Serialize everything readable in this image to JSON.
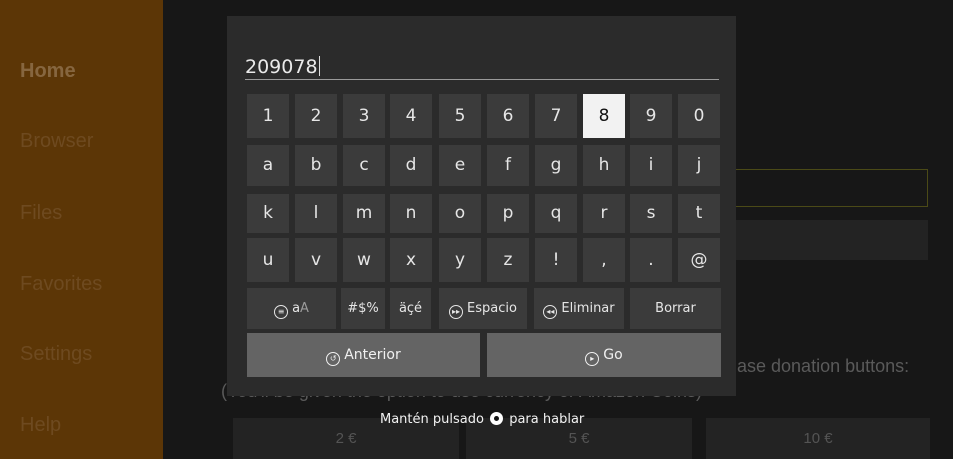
{
  "sidebar": {
    "items": [
      {
        "label": "Home"
      },
      {
        "label": "Browser"
      },
      {
        "label": "Files"
      },
      {
        "label": "Favorites"
      },
      {
        "label": "Settings"
      },
      {
        "label": "Help"
      }
    ]
  },
  "background": {
    "donation_text": "ase donation buttons:",
    "donation_sub": "(You'll be given the option to use currency or Amazon Coins)",
    "buttons": [
      "2 €",
      "5 €",
      "10 €"
    ]
  },
  "keyboard": {
    "input_value": "209078",
    "rows": [
      [
        "1",
        "2",
        "3",
        "4",
        "5",
        "6",
        "7",
        "8",
        "9",
        "0"
      ],
      [
        "a",
        "b",
        "c",
        "d",
        "e",
        "f",
        "g",
        "h",
        "i",
        "j"
      ],
      [
        "k",
        "l",
        "m",
        "n",
        "o",
        "p",
        "q",
        "r",
        "s",
        "t"
      ],
      [
        "u",
        "v",
        "w",
        "x",
        "y",
        "z",
        "!",
        ",",
        ".",
        "@"
      ]
    ],
    "focused_key": "8",
    "function_row": {
      "case_small": "a",
      "case_big": "A",
      "symbols": "#$%",
      "accents": "äçé",
      "space": "Espacio",
      "delete": "Eliminar",
      "clear": "Borrar"
    },
    "previous": "Anterior",
    "go": "Go"
  },
  "hint": {
    "before": "Mantén pulsado",
    "after": "para hablar"
  }
}
